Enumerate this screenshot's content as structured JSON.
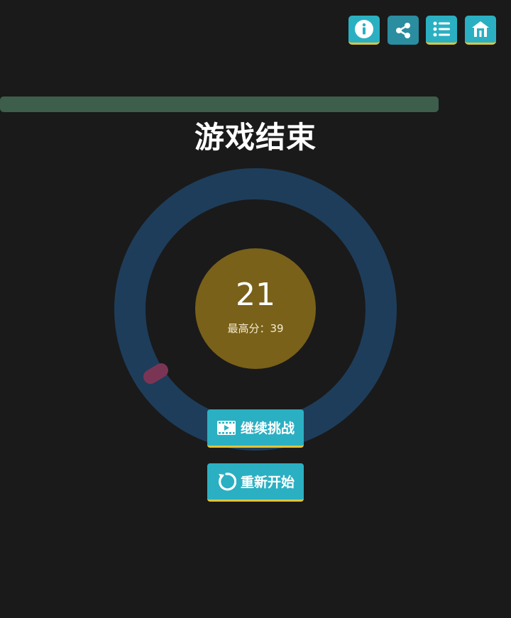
{
  "header": {
    "buttons": [
      {
        "name": "info",
        "icon": "info-icon"
      },
      {
        "name": "share",
        "icon": "share-icon"
      },
      {
        "name": "list",
        "icon": "list-icon"
      },
      {
        "name": "home",
        "icon": "home-icon"
      }
    ]
  },
  "progress": {
    "fraction": 1.0,
    "color": "#3d5e4b"
  },
  "title": "游戏结束",
  "score": {
    "value": "21",
    "best_label": "最高分：39"
  },
  "ring": {
    "ring_color": "#1e3d5a",
    "marker_color": "#7a3555",
    "center_color": "#7a6119"
  },
  "buttons": {
    "continue_label": "继续挑战",
    "continue_icon": "video-icon",
    "restart_label": "重新开始",
    "restart_icon": "restart-icon"
  },
  "colors": {
    "background": "#1a1a1a",
    "button": "#2ab0c2",
    "button_accent": "#e3c23a"
  }
}
